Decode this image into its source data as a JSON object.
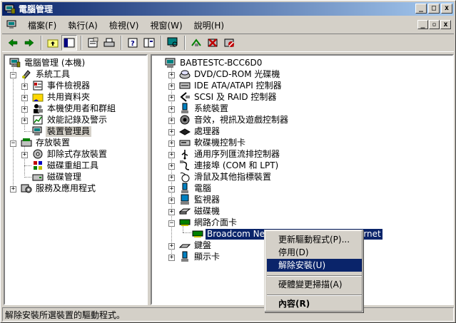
{
  "window": {
    "title": "電腦管理"
  },
  "menu": {
    "items": [
      {
        "label": "檔案(F)"
      },
      {
        "label": "執行(A)"
      },
      {
        "label": "檢視(V)"
      },
      {
        "label": "視窗(W)"
      },
      {
        "label": "說明(H)"
      }
    ]
  },
  "left_tree": {
    "root": "電腦管理 (本機)",
    "system_tools": "系統工具",
    "event_viewer": "事件檢視器",
    "shared_folders": "共用資料夾",
    "local_users": "本機使用者和群組",
    "perf_logs": "效能記錄及警示",
    "device_manager": "裝置管理員",
    "storage": "存放裝置",
    "removable": "卸除式存放裝置",
    "defrag": "磁碟重組工具",
    "disk_mgmt": "磁碟管理",
    "services": "服務及應用程式"
  },
  "right_tree": {
    "root": "BABTESTC-BCC6D0",
    "items": [
      "DVD/CD-ROM 光碟機",
      "IDE ATA/ATAPI 控制器",
      "SCSI 及 RAID 控制器",
      "系統裝置",
      "音效，視訊及遊戲控制器",
      "處理器",
      "軟碟機控制卡",
      "通用序列匯流排控制器",
      "連接埠 (COM 和 LPT)",
      "滑鼠及其他指標裝置",
      "電腦",
      "監視器",
      "磁碟機",
      "網路介面卡",
      "鍵盤",
      "顯示卡"
    ],
    "selected_child": "Broadcom NetLink (TM) Gigabit Ethernet"
  },
  "context_menu": {
    "update_driver": "更新驅動程式(P)...",
    "disable": "停用(D)",
    "uninstall": "解除安裝(U)",
    "scan": "硬體變更掃描(A)",
    "properties": "內容(R)"
  },
  "status": {
    "text": "解除安裝所選裝置的驅動程式。"
  }
}
